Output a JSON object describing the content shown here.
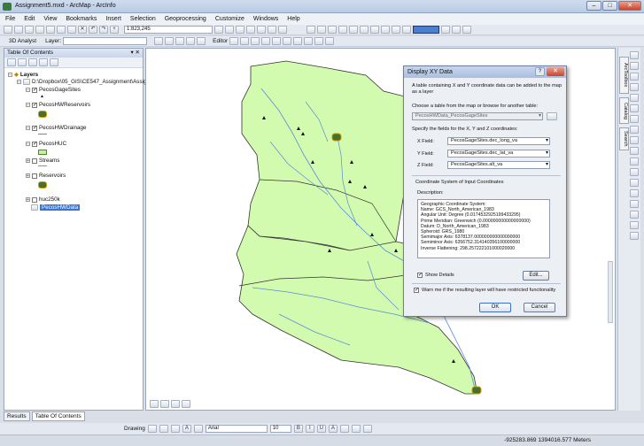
{
  "window": {
    "title": "Assignment5.mxd - ArcMap - ArcInfo"
  },
  "menu": [
    "File",
    "Edit",
    "View",
    "Bookmarks",
    "Insert",
    "Selection",
    "Geoprocessing",
    "Customize",
    "Windows",
    "Help"
  ],
  "toolbar": {
    "scale": "1:823,245",
    "analyst_label": "3D Analyst",
    "layer_label": "Layer:",
    "editor_label": "Editor"
  },
  "toc": {
    "title": "Table Of Contents",
    "root": "Layers",
    "path": "D:\\Dropbox\\05_GIS\\CE547_Assignment\\Assignm",
    "layers": [
      "PecosGageSites",
      "PecosHWReservoirs",
      "PecosHWDrainage",
      "PecosHUC",
      "Streams",
      "Reservoirs",
      "huc250k",
      "PecosHWData"
    ]
  },
  "tabs": {
    "results": "Results",
    "toc": "Table Of Contents"
  },
  "draw": {
    "label": "Drawing",
    "font": "Arial",
    "size": "10"
  },
  "status": {
    "coords": "-925283.869  1394016.577 Meters"
  },
  "dialog": {
    "title": "Display XY Data",
    "intro": "A table containing X and Y coordinate data can be added to the map as a layer",
    "choose_label": "Choose a table from the map or browse for another table:",
    "table_value": "PecosHWData_PecosGageSites",
    "specify_label": "Specify the fields for the X, Y and Z coordinates:",
    "x_label": "X Field:",
    "x_value": "PecosGageSites.dec_long_va",
    "y_label": "Y Field:",
    "y_value": "PecosGageSites.dec_lat_va",
    "z_label": "Z Field:",
    "z_value": "PecosGageSites.alt_va",
    "crs_label": "Coordinate System of Input Coordinates",
    "desc_label": "Description:",
    "desc_lines": [
      "Geographic Coordinate System:",
      "  Name: GCS_North_American_1983",
      "  Angular Unit: Degree (0.0174532925199433295)",
      "  Prime Meridian: Greenwich (0.000000000000000000)",
      "  Datum: D_North_American_1983",
      "    Spheroid: GRS_1980",
      "      Semimajor Axis: 6378137.000000000000000000",
      "      Semiminor Axis: 6356752.314140356100000000",
      "      Inverse Flattening: 298.257222101000020000"
    ],
    "show_details": "Show Details",
    "edit": "Edit...",
    "warn": "Warn me if the resulting layer will have restricted functionality",
    "ok": "OK",
    "cancel": "Cancel"
  },
  "dock": {
    "arctoolbox": "ArcToolbox",
    "catalog": "Catalog",
    "search": "Search"
  }
}
